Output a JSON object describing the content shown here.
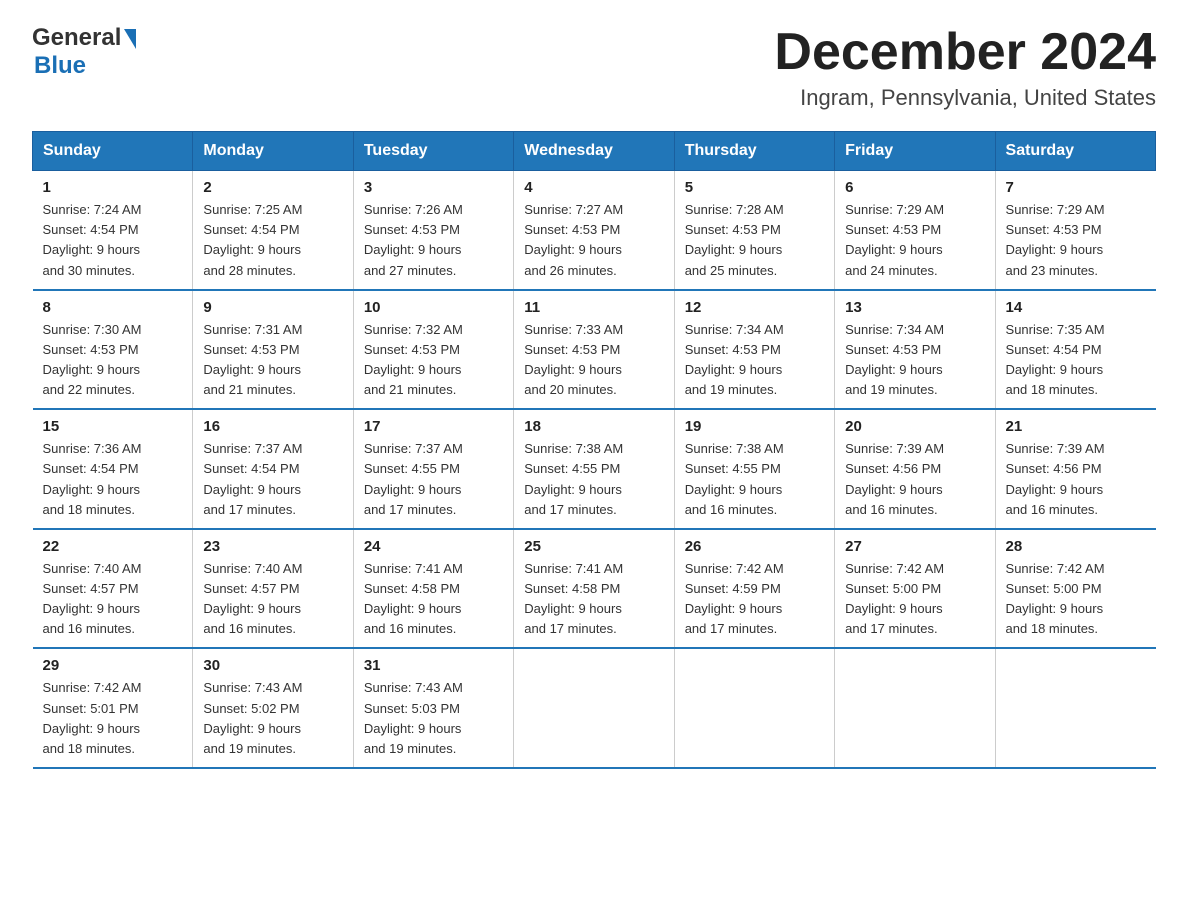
{
  "header": {
    "logo_general": "General",
    "logo_blue": "Blue",
    "month_title": "December 2024",
    "location": "Ingram, Pennsylvania, United States"
  },
  "days_of_week": [
    "Sunday",
    "Monday",
    "Tuesday",
    "Wednesday",
    "Thursday",
    "Friday",
    "Saturday"
  ],
  "weeks": [
    [
      {
        "day": "1",
        "sunrise": "7:24 AM",
        "sunset": "4:54 PM",
        "daylight": "9 hours and 30 minutes."
      },
      {
        "day": "2",
        "sunrise": "7:25 AM",
        "sunset": "4:54 PM",
        "daylight": "9 hours and 28 minutes."
      },
      {
        "day": "3",
        "sunrise": "7:26 AM",
        "sunset": "4:53 PM",
        "daylight": "9 hours and 27 minutes."
      },
      {
        "day": "4",
        "sunrise": "7:27 AM",
        "sunset": "4:53 PM",
        "daylight": "9 hours and 26 minutes."
      },
      {
        "day": "5",
        "sunrise": "7:28 AM",
        "sunset": "4:53 PM",
        "daylight": "9 hours and 25 minutes."
      },
      {
        "day": "6",
        "sunrise": "7:29 AM",
        "sunset": "4:53 PM",
        "daylight": "9 hours and 24 minutes."
      },
      {
        "day": "7",
        "sunrise": "7:29 AM",
        "sunset": "4:53 PM",
        "daylight": "9 hours and 23 minutes."
      }
    ],
    [
      {
        "day": "8",
        "sunrise": "7:30 AM",
        "sunset": "4:53 PM",
        "daylight": "9 hours and 22 minutes."
      },
      {
        "day": "9",
        "sunrise": "7:31 AM",
        "sunset": "4:53 PM",
        "daylight": "9 hours and 21 minutes."
      },
      {
        "day": "10",
        "sunrise": "7:32 AM",
        "sunset": "4:53 PM",
        "daylight": "9 hours and 21 minutes."
      },
      {
        "day": "11",
        "sunrise": "7:33 AM",
        "sunset": "4:53 PM",
        "daylight": "9 hours and 20 minutes."
      },
      {
        "day": "12",
        "sunrise": "7:34 AM",
        "sunset": "4:53 PM",
        "daylight": "9 hours and 19 minutes."
      },
      {
        "day": "13",
        "sunrise": "7:34 AM",
        "sunset": "4:53 PM",
        "daylight": "9 hours and 19 minutes."
      },
      {
        "day": "14",
        "sunrise": "7:35 AM",
        "sunset": "4:54 PM",
        "daylight": "9 hours and 18 minutes."
      }
    ],
    [
      {
        "day": "15",
        "sunrise": "7:36 AM",
        "sunset": "4:54 PM",
        "daylight": "9 hours and 18 minutes."
      },
      {
        "day": "16",
        "sunrise": "7:37 AM",
        "sunset": "4:54 PM",
        "daylight": "9 hours and 17 minutes."
      },
      {
        "day": "17",
        "sunrise": "7:37 AM",
        "sunset": "4:55 PM",
        "daylight": "9 hours and 17 minutes."
      },
      {
        "day": "18",
        "sunrise": "7:38 AM",
        "sunset": "4:55 PM",
        "daylight": "9 hours and 17 minutes."
      },
      {
        "day": "19",
        "sunrise": "7:38 AM",
        "sunset": "4:55 PM",
        "daylight": "9 hours and 16 minutes."
      },
      {
        "day": "20",
        "sunrise": "7:39 AM",
        "sunset": "4:56 PM",
        "daylight": "9 hours and 16 minutes."
      },
      {
        "day": "21",
        "sunrise": "7:39 AM",
        "sunset": "4:56 PM",
        "daylight": "9 hours and 16 minutes."
      }
    ],
    [
      {
        "day": "22",
        "sunrise": "7:40 AM",
        "sunset": "4:57 PM",
        "daylight": "9 hours and 16 minutes."
      },
      {
        "day": "23",
        "sunrise": "7:40 AM",
        "sunset": "4:57 PM",
        "daylight": "9 hours and 16 minutes."
      },
      {
        "day": "24",
        "sunrise": "7:41 AM",
        "sunset": "4:58 PM",
        "daylight": "9 hours and 16 minutes."
      },
      {
        "day": "25",
        "sunrise": "7:41 AM",
        "sunset": "4:58 PM",
        "daylight": "9 hours and 17 minutes."
      },
      {
        "day": "26",
        "sunrise": "7:42 AM",
        "sunset": "4:59 PM",
        "daylight": "9 hours and 17 minutes."
      },
      {
        "day": "27",
        "sunrise": "7:42 AM",
        "sunset": "5:00 PM",
        "daylight": "9 hours and 17 minutes."
      },
      {
        "day": "28",
        "sunrise": "7:42 AM",
        "sunset": "5:00 PM",
        "daylight": "9 hours and 18 minutes."
      }
    ],
    [
      {
        "day": "29",
        "sunrise": "7:42 AM",
        "sunset": "5:01 PM",
        "daylight": "9 hours and 18 minutes."
      },
      {
        "day": "30",
        "sunrise": "7:43 AM",
        "sunset": "5:02 PM",
        "daylight": "9 hours and 19 minutes."
      },
      {
        "day": "31",
        "sunrise": "7:43 AM",
        "sunset": "5:03 PM",
        "daylight": "9 hours and 19 minutes."
      },
      null,
      null,
      null,
      null
    ]
  ],
  "labels": {
    "sunrise": "Sunrise:",
    "sunset": "Sunset:",
    "daylight": "Daylight:"
  }
}
